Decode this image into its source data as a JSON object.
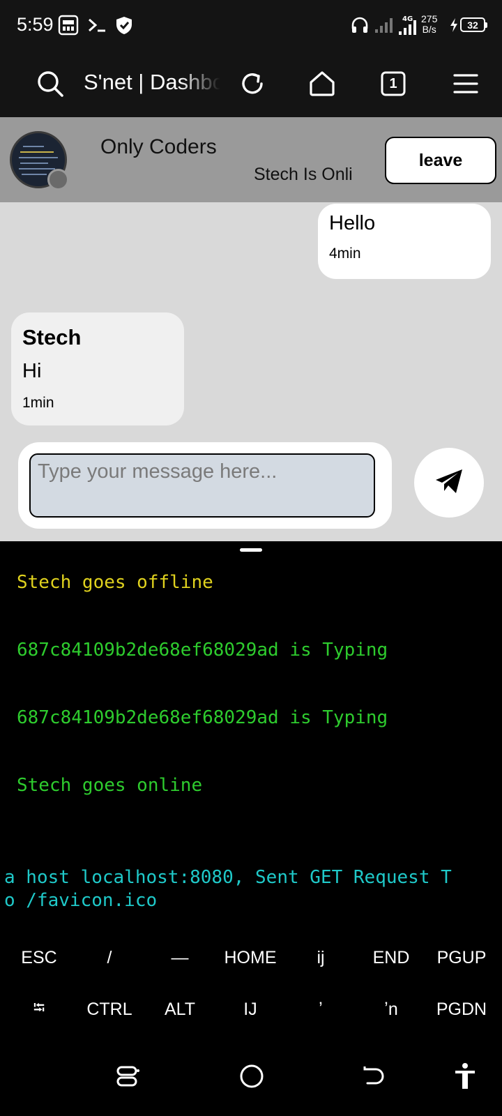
{
  "status_bar": {
    "time": "5:59",
    "network_speed_value": "275",
    "network_speed_unit": "B/s",
    "network_type": "4G",
    "battery": "32",
    "icons": [
      "app-notification-icon",
      "terminal-icon",
      "shield-icon",
      "headphones-icon",
      "signal-icon",
      "signal-4g-icon",
      "charging-icon"
    ]
  },
  "browser": {
    "title": "S'net | Dashboard",
    "tab_count": "1",
    "icons": [
      "search-icon",
      "reload-icon",
      "home-icon",
      "tabs-icon",
      "menu-icon"
    ]
  },
  "chat_header": {
    "group_name": "Only Coders",
    "status_text": "Stech Is Onli",
    "leave_label": "leave"
  },
  "messages": [
    {
      "direction": "outgoing",
      "text": "Hello",
      "time": "4min"
    },
    {
      "direction": "incoming",
      "sender": "Stech",
      "text": "Hi",
      "time": "1min"
    }
  ],
  "composer": {
    "placeholder": "Type your message here...",
    "value": ""
  },
  "terminal": {
    "lines": [
      {
        "text": "Stech goes offline",
        "color": "#e0d21e"
      },
      {
        "text": "687c84109b2de68ef68029ad is Typing",
        "color": "#2ecc2e"
      },
      {
        "text": "687c84109b2de68ef68029ad is Typing",
        "color": "#2ecc2e"
      },
      {
        "text": "Stech goes online",
        "color": "#2ecc2e"
      }
    ],
    "log_line_1": "a host localhost:8080, Sent GET Request T",
    "log_line_2": "o /favicon.ico",
    "log_color": "#1fc9c9"
  },
  "extra_keys": {
    "row1": [
      "ESC",
      "/",
      "—",
      "HOME",
      "ij",
      "END",
      "PGUP"
    ],
    "row2": [
      "⭾",
      "CTRL",
      "ALT",
      "IJ",
      "ʼ",
      "ʼn",
      "PGDN"
    ]
  },
  "nav_bar": {
    "icons": [
      "recent-apps-icon",
      "home-circle-icon",
      "back-icon",
      "accessibility-icon"
    ]
  }
}
